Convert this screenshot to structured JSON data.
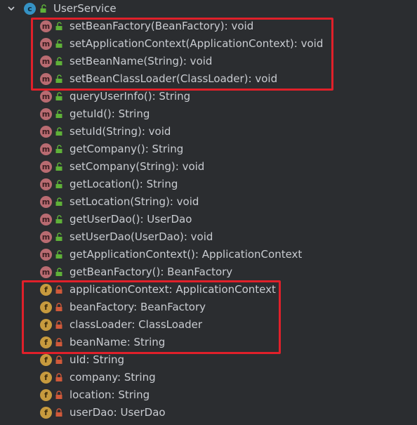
{
  "class_node": {
    "label": "UserService",
    "icon": "c",
    "expand_state": "expanded"
  },
  "members": [
    {
      "kind": "m",
      "visibility": "public",
      "label": "setBeanFactory(BeanFactory): void"
    },
    {
      "kind": "m",
      "visibility": "public",
      "label": "setApplicationContext(ApplicationContext): void"
    },
    {
      "kind": "m",
      "visibility": "public",
      "label": "setBeanName(String): void"
    },
    {
      "kind": "m",
      "visibility": "public",
      "label": "setBeanClassLoader(ClassLoader): void"
    },
    {
      "kind": "m",
      "visibility": "public",
      "label": "queryUserInfo(): String"
    },
    {
      "kind": "m",
      "visibility": "public",
      "label": "getuId(): String"
    },
    {
      "kind": "m",
      "visibility": "public",
      "label": "setuId(String): void"
    },
    {
      "kind": "m",
      "visibility": "public",
      "label": "getCompany(): String"
    },
    {
      "kind": "m",
      "visibility": "public",
      "label": "setCompany(String): void"
    },
    {
      "kind": "m",
      "visibility": "public",
      "label": "getLocation(): String"
    },
    {
      "kind": "m",
      "visibility": "public",
      "label": "setLocation(String): void"
    },
    {
      "kind": "m",
      "visibility": "public",
      "label": "getUserDao(): UserDao"
    },
    {
      "kind": "m",
      "visibility": "public",
      "label": "setUserDao(UserDao): void"
    },
    {
      "kind": "m",
      "visibility": "public",
      "label": "getApplicationContext(): ApplicationContext"
    },
    {
      "kind": "m",
      "visibility": "public",
      "label": "getBeanFactory(): BeanFactory"
    },
    {
      "kind": "f",
      "visibility": "private",
      "label": "applicationContext: ApplicationContext"
    },
    {
      "kind": "f",
      "visibility": "private",
      "label": "beanFactory: BeanFactory"
    },
    {
      "kind": "f",
      "visibility": "private",
      "label": "classLoader: ClassLoader"
    },
    {
      "kind": "f",
      "visibility": "private",
      "label": "beanName: String"
    },
    {
      "kind": "f",
      "visibility": "private",
      "label": "uId: String"
    },
    {
      "kind": "f",
      "visibility": "private",
      "label": "company: String"
    },
    {
      "kind": "f",
      "visibility": "private",
      "label": "location: String"
    },
    {
      "kind": "f",
      "visibility": "private",
      "label": "userDao: UserDao"
    }
  ],
  "highlights": [
    {
      "first_index": 0,
      "last_index": 3
    },
    {
      "first_index": 15,
      "last_index": 18
    }
  ],
  "colors": {
    "background": "#2b2d30",
    "text": "#c9ccd1",
    "method_icon": "#b96b71",
    "field_icon": "#c79a3e",
    "public_lock": "#5fb139",
    "private_lock": "#d0593a",
    "class_icon": "#3592c4",
    "highlight_box": "#e0202a"
  }
}
